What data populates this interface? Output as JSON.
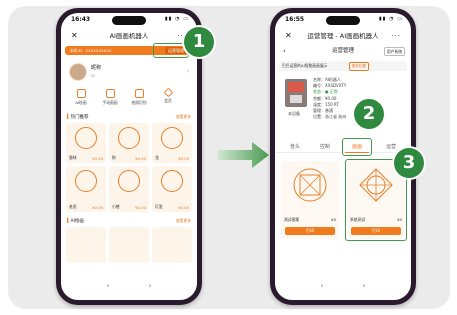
{
  "left_phone": {
    "time": "16:43",
    "title": "AI画画机器人",
    "banner_text": "本机ID：XXXXXXXXXX",
    "ops_button": "运营管理",
    "user_name": "昵称",
    "user_sub": "ID",
    "user_tag": "",
    "menu": [
      {
        "icon": "robot-icon",
        "label": "AI绘画"
      },
      {
        "icon": "pen-icon",
        "label": "手动画画"
      },
      {
        "icon": "camera-icon",
        "label": "拍照识别"
      },
      {
        "icon": "diamond-icon",
        "label": "会员"
      }
    ],
    "section1": "热门推荐",
    "cards": [
      {
        "label": "猫咪",
        "price": "¥0.00"
      },
      {
        "label": "狗",
        "price": "¥0.00"
      },
      {
        "label": "龙",
        "price": "¥0.00"
      },
      {
        "label": "老虎",
        "price": "¥0.00"
      },
      {
        "label": "小猪",
        "price": "¥0.00"
      },
      {
        "label": "灯笼",
        "price": "¥0.00"
      }
    ],
    "section2": "AI绘画",
    "more": "查看更多"
  },
  "right_phone": {
    "time": "16:55",
    "title": "运营管理 - AI画画机器人",
    "page_title": "运营管理",
    "page_action": "用户系统",
    "shop_name": "巴巴运营的AI智能画画展示",
    "shop_btn": "更新位置",
    "device_caption": "本设备",
    "info_rows": [
      "名称：AI机器人",
      "编号：XXSDVXTY",
      "状态：● 正常",
      "余额：¥0.00",
      "温度：150 RT",
      "管理：普通",
      "位置：浙江省 杭州"
    ],
    "tabs": [
      "普头",
      "控制",
      "画画",
      "运营"
    ],
    "active_tab": 2,
    "cards": [
      {
        "label": "测试图案",
        "price": "¥0",
        "button": "打印"
      },
      {
        "label": "系统测试",
        "price": "¥0",
        "button": "打印"
      }
    ]
  },
  "steps": [
    "1",
    "2",
    "3"
  ],
  "colors": {
    "accent": "#f07a1e",
    "step_green": "#2f8a40",
    "arrow_green": "#4a9a52"
  }
}
